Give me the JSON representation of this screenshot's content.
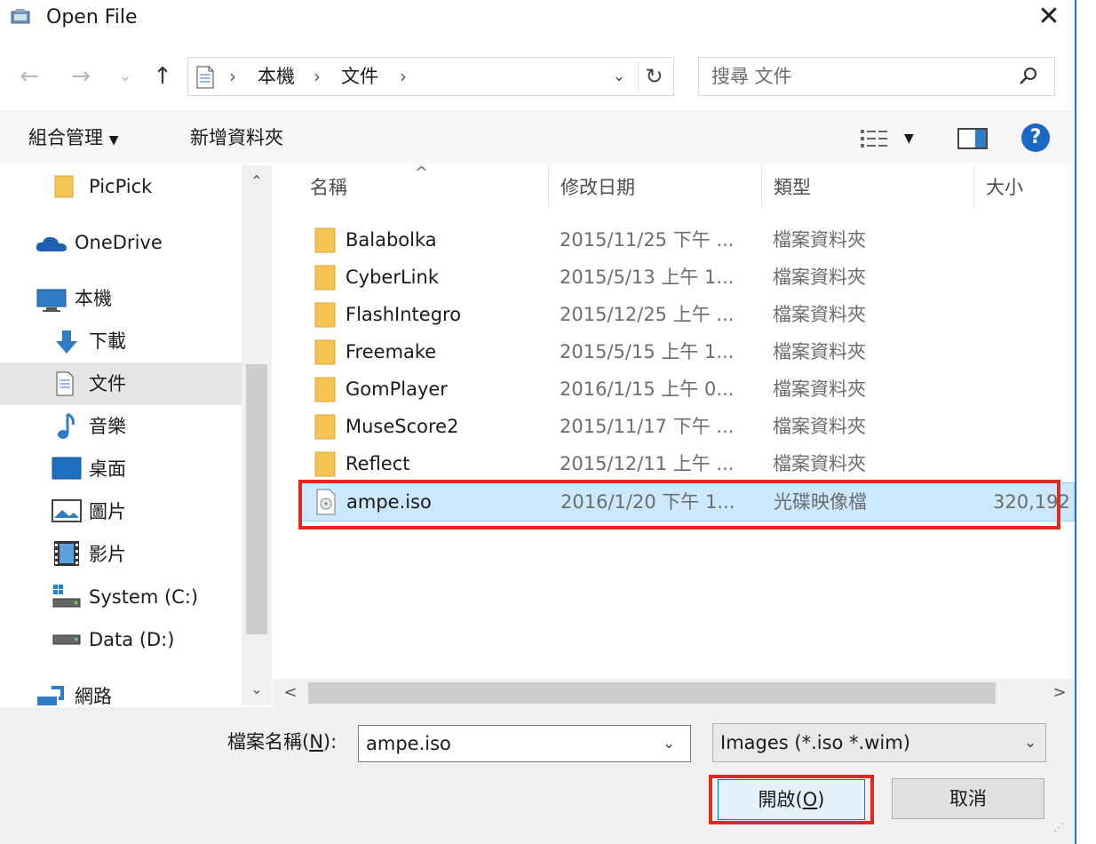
{
  "window": {
    "title": "Open File",
    "close_glyph": "✕"
  },
  "nav_buttons": {
    "back": "←",
    "forward": "→",
    "recent": "⌄",
    "up": "↑"
  },
  "address": {
    "separator": "›",
    "crumbs": [
      "本機",
      "文件"
    ],
    "dropdown_glyph": "⌄",
    "refresh_glyph": "↻"
  },
  "search": {
    "placeholder": "搜尋 文件"
  },
  "toolbar": {
    "organize": "組合管理",
    "organize_caret": "▼",
    "new_folder": "新增資料夾",
    "view_caret": "▼",
    "help": "?"
  },
  "nav_pane": {
    "items": [
      {
        "label": "PicPick",
        "icon": "folder-icon"
      },
      {
        "label": "OneDrive",
        "icon": "cloud-icon"
      },
      {
        "label": "本機",
        "icon": "computer-icon"
      },
      {
        "label": "下載",
        "icon": "download-icon"
      },
      {
        "label": "文件",
        "icon": "documents-icon",
        "selected": true
      },
      {
        "label": "音樂",
        "icon": "music-icon"
      },
      {
        "label": "桌面",
        "icon": "desktop-icon"
      },
      {
        "label": "圖片",
        "icon": "pictures-icon"
      },
      {
        "label": "影片",
        "icon": "videos-icon"
      },
      {
        "label": "System (C:)",
        "icon": "system-drive-icon"
      },
      {
        "label": "Data (D:)",
        "icon": "drive-icon"
      },
      {
        "label": "網路",
        "icon": "network-icon"
      }
    ],
    "scroll_up": "⌃",
    "scroll_down": "⌄"
  },
  "file_list": {
    "columns": {
      "name": "名稱",
      "date": "修改日期",
      "type": "類型",
      "size": "大小"
    },
    "sort_glyph": "^",
    "rows": [
      {
        "name": "Balabolka",
        "date": "2015/11/25 下午 ...",
        "type": "檔案資料夾",
        "size": "",
        "icon": "folder-icon"
      },
      {
        "name": "CyberLink",
        "date": "2015/5/13 上午 1...",
        "type": "檔案資料夾",
        "size": "",
        "icon": "folder-icon"
      },
      {
        "name": "FlashIntegro",
        "date": "2015/12/25 上午 ...",
        "type": "檔案資料夾",
        "size": "",
        "icon": "folder-icon"
      },
      {
        "name": "Freemake",
        "date": "2015/5/15 上午 1...",
        "type": "檔案資料夾",
        "size": "",
        "icon": "folder-icon"
      },
      {
        "name": "GomPlayer",
        "date": "2016/1/15 上午 0...",
        "type": "檔案資料夾",
        "size": "",
        "icon": "folder-icon"
      },
      {
        "name": "MuseScore2",
        "date": "2015/11/17 下午 ...",
        "type": "檔案資料夾",
        "size": "",
        "icon": "folder-icon"
      },
      {
        "name": "Reflect",
        "date": "2015/12/11 上午 ...",
        "type": "檔案資料夾",
        "size": "",
        "icon": "folder-icon"
      },
      {
        "name": "ampe.iso",
        "date": "2016/1/20 下午 1...",
        "type": "光碟映像檔",
        "size": "320,192",
        "icon": "disc-image-icon",
        "selected": true
      }
    ],
    "hscroll_left": "<",
    "hscroll_right": ">"
  },
  "bottom": {
    "filename_label_pre": "檔案名稱(",
    "filename_label_key": "N",
    "filename_label_post": "):",
    "filename_value": "ampe.iso",
    "dropdown_glyph": "⌄",
    "filetype_value": "Images (*.iso *.wim)",
    "open_label_pre": "開啟(",
    "open_label_key": "O",
    "open_label_post": ")",
    "cancel_label": "取消"
  },
  "colors": {
    "selection_bg": "#cce8ff",
    "highlight_border": "#e02a1f",
    "folder": "#f5c452",
    "accent": "#0078d7"
  }
}
